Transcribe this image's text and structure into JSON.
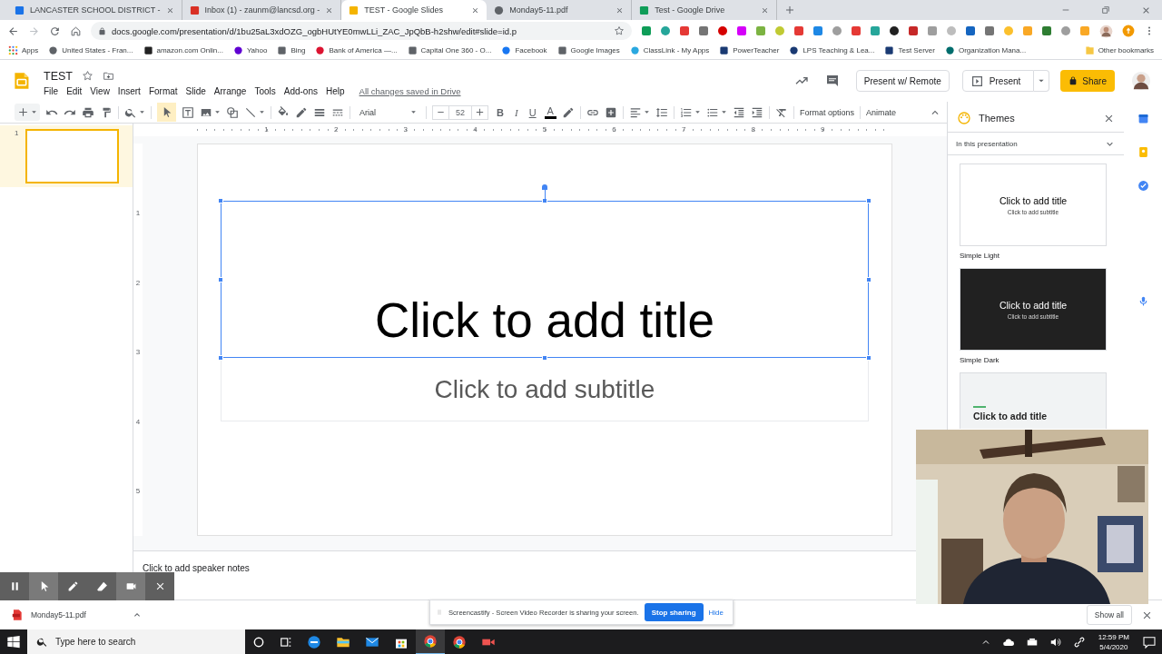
{
  "browser": {
    "tabs": [
      {
        "title": "LANCASTER SCHOOL DISTRICT - ",
        "selected": false
      },
      {
        "title": "Inbox (1) - zaunm@lancsd.org - ",
        "selected": false
      },
      {
        "title": "TEST - Google Slides",
        "selected": true
      },
      {
        "title": "Monday5-11.pdf",
        "selected": false
      },
      {
        "title": "Test - Google Drive",
        "selected": false
      }
    ],
    "address": "docs.google.com/presentation/d/1bu25aL3xdOZG_ogbHUtYE0mwLLi_ZAC_JpQbB-h2shw/edit#slide=id.p",
    "bookmarks": [
      "Apps",
      "United States - Fran...",
      "amazon.com Onlin...",
      "Yahoo",
      "Bing",
      "Bank of America —...",
      "Capital One 360 - O...",
      "Facebook",
      "Google Images",
      "ClassLink - My Apps",
      "PowerTeacher",
      "LPS Teaching & Lea...",
      "Test Server",
      "Organization Mana..."
    ],
    "other_bookmarks": "Other bookmarks"
  },
  "document": {
    "title": "TEST",
    "menus": [
      "File",
      "Edit",
      "View",
      "Insert",
      "Format",
      "Slide",
      "Arrange",
      "Tools",
      "Add-ons",
      "Help"
    ],
    "save_status": "All changes saved in Drive"
  },
  "actions": {
    "present_remote": "Present w/ Remote",
    "present": "Present",
    "share": "Share"
  },
  "toolbar": {
    "font": "Arial",
    "font_size": "52",
    "style_buttons": [
      {
        "label": "B",
        "kind": "bold"
      },
      {
        "label": "I",
        "kind": "italic"
      },
      {
        "label": "U",
        "kind": "underline"
      },
      {
        "label": "A",
        "kind": "color"
      }
    ],
    "format_options": "Format options",
    "animate": "Animate"
  },
  "filmstrip": [
    {
      "number": "1",
      "selected": true
    }
  ],
  "ruler": {
    "horizontal": [
      "1",
      "2",
      "3",
      "4",
      "5",
      "6",
      "7",
      "8",
      "9"
    ],
    "vertical": [
      "1",
      "2",
      "3",
      "4",
      "5"
    ]
  },
  "slide": {
    "title": "Click to add title",
    "subtitle": "Click to add subtitle",
    "title_selected": true
  },
  "speaker_notes": {
    "placeholder": "Click to add speaker notes"
  },
  "themes": {
    "title": "Themes",
    "section": "In this presentation",
    "items": [
      {
        "name": "Simple Light",
        "preview_title": "Click to add title",
        "preview_subtitle": "Click to add subtitle",
        "kind": "light"
      },
      {
        "name": "Simple Dark",
        "preview_title": "Click to add title",
        "preview_subtitle": "Click to add subtitle",
        "kind": "dark"
      },
      {
        "preview_title": "Click to add title",
        "kind": "streamline"
      }
    ]
  },
  "recorder": {
    "tools": [
      {
        "kind": "pause",
        "selected": false
      },
      {
        "kind": "pointer",
        "selected": true
      },
      {
        "kind": "pen",
        "selected": false
      },
      {
        "kind": "eraser",
        "selected": false
      },
      {
        "kind": "camera",
        "selected": true
      },
      {
        "kind": "close",
        "selected": false
      }
    ]
  },
  "sharing_bar": {
    "message": "Screencastify - Screen Video Recorder is sharing your screen.",
    "stop": "Stop sharing",
    "hide": "Hide"
  },
  "downloads": {
    "file": "Monday5-11.pdf",
    "show_all": "Show all"
  },
  "taskbar": {
    "search_placeholder": "Type here to search",
    "time": "12:59 PM",
    "date": "5/4/2020"
  }
}
